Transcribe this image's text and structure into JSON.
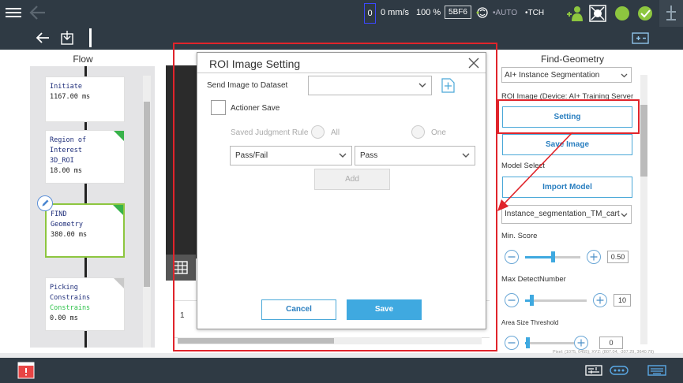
{
  "status": {
    "speed_zero": "0",
    "speed": "0 mm/s",
    "speed_percent": "100 %",
    "project_code": "5BF6",
    "mode_auto": "AUTO",
    "mode_tch": "TCH"
  },
  "flow": {
    "title": "Flow",
    "nodes": [
      {
        "title": "Initiate",
        "time": "1167.00 ms"
      },
      {
        "title": "Region of Interest",
        "sub": "3D_ROI",
        "time": "18.00 ms"
      },
      {
        "title": "FIND",
        "sub": "Geometry",
        "time": "380.00 ms"
      },
      {
        "title": "Picking Constrains",
        "sub": "Constrains",
        "time": "0.00 ms"
      }
    ]
  },
  "canvas": {
    "table_cell": "1"
  },
  "dialog": {
    "title": "ROI Image Setting",
    "send_label": "Send Image to Dataset",
    "send_value": "",
    "actioner_save_label": "Actioner Save",
    "saved_rule_label": "Saved Judgment Rule",
    "radio_all": "All",
    "radio_one": "One",
    "select1_value": "Pass/Fail",
    "select2_value": "Pass",
    "add_label": "Add",
    "cancel_label": "Cancel",
    "save_label": "Save"
  },
  "right": {
    "title": "Find-Geometry",
    "mode_select": "AI+ Instance Segmentation",
    "roi_label": "ROI Image (Device: AI+ Training Server",
    "setting_label": "Setting",
    "save_image_label": "Save Image",
    "model_select_label": "Model Select",
    "import_model_label": "Import Model",
    "model_value": "Instance_segmentation_TM_carton",
    "min_score_label": "Min. Score",
    "min_score_value": "0.50",
    "min_score_fraction": 0.5,
    "max_detect_label": "Max DetectNumber",
    "max_detect_value": "10",
    "max_detect_fraction": 0.1,
    "area_label": "Area Size Threshold",
    "area_value": "0",
    "area_fraction": 0.05
  },
  "footer": {
    "coords": "Pixel: (1075, 0455); XYZ: (807.04, -307.29, 3640.79)"
  },
  "colors": {
    "topbar": "#2f3a44",
    "accent_blue": "#3fa9e0",
    "highlight_red": "#e0242b",
    "node_green": "#38b24a"
  }
}
